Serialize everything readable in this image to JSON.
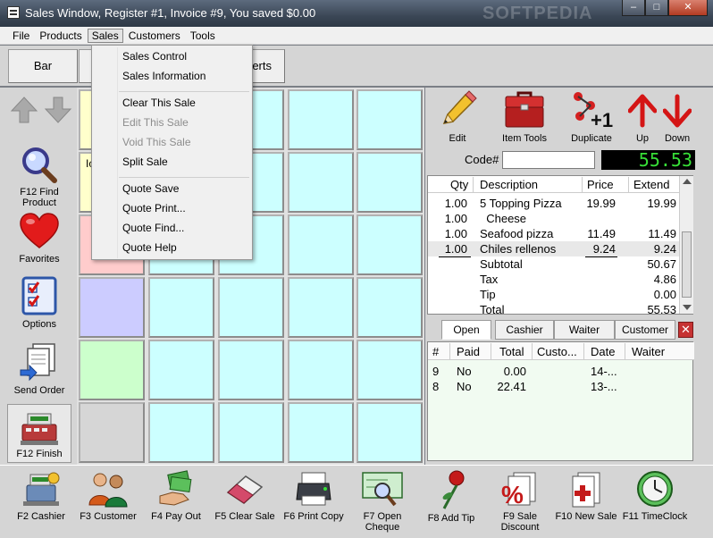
{
  "window": {
    "title": "Sales Window,  Register #1,  Invoice #9, You saved $0.00",
    "watermark": "SOFTPEDIA",
    "btn_minimize": "–",
    "btn_maximize": "□",
    "btn_close": "✕"
  },
  "menubar": {
    "items": [
      "File",
      "Products",
      "Sales",
      "Customers",
      "Tools"
    ]
  },
  "sales_menu": {
    "items": [
      "Sales Control",
      "Sales Information",
      "Clear This Sale",
      "Edit This Sale",
      "Void This Sale",
      "Split Sale",
      "Quote Save",
      "Quote Print...",
      "Quote Find...",
      "Quote Help"
    ]
  },
  "topbar": {
    "tab_bar": "Bar",
    "tab_partial": "erts"
  },
  "sidebar": {
    "find_product": "F12 Find Product",
    "favorites": "Favorites",
    "options": "Options",
    "send_order": "Send Order",
    "finish": "F12 Finish"
  },
  "grid": {
    "partial_label": "Ic"
  },
  "tools": {
    "edit": "Edit",
    "item_tools": "Item Tools",
    "duplicate": "Duplicate",
    "up": "Up",
    "down": "Down"
  },
  "code": {
    "label": "Code#",
    "value": ""
  },
  "total_display": "55.53",
  "order": {
    "headers": [
      "Qty",
      "Description",
      "Price",
      "Extend"
    ],
    "items": [
      {
        "qty": "1.00",
        "desc": "5 Topping Pizza",
        "price": "19.99",
        "extend": "19.99"
      },
      {
        "qty": "1.00",
        "desc": "  Cheese",
        "price": "",
        "extend": ""
      },
      {
        "qty": "1.00",
        "desc": "Seafood pizza",
        "price": "11.49",
        "extend": "11.49"
      },
      {
        "qty": "1.00",
        "desc": "Chiles rellenos",
        "price": "9.24",
        "extend": "9.24"
      }
    ],
    "summary": [
      {
        "label": "Subtotal",
        "value": "50.67"
      },
      {
        "label": "Tax",
        "value": "4.86"
      },
      {
        "label": "Tip",
        "value": "0.00"
      },
      {
        "label": "Total",
        "value": "55.53"
      }
    ]
  },
  "tabs2": [
    "Open",
    "Cashier",
    "Waiter",
    "Customer"
  ],
  "open_list": {
    "headers": [
      "#",
      "Paid",
      "Total",
      "Custo...",
      "Date",
      "Waiter"
    ],
    "rows": [
      {
        "num": "9",
        "paid": "No",
        "total": "0.00",
        "customer": "",
        "date": "14-...",
        "waiter": ""
      },
      {
        "num": "8",
        "paid": "No",
        "total": "22.41",
        "customer": "",
        "date": "13-...",
        "waiter": ""
      }
    ]
  },
  "bottombar": {
    "cashier": "F2 Cashier",
    "customer": "F3 Customer",
    "pay_out": "F4 Pay Out",
    "clear_sale": "F5 Clear Sale",
    "print_copy": "F6 Print Copy",
    "open_cheque": "F7 Open Cheque",
    "add_tip": "F8 Add Tip",
    "sale_discount": "F9 Sale Discount",
    "new_sale": "F10 New Sale",
    "timeclock": "F11 TimeClock"
  },
  "colors": {
    "cell_cyan": "#ccffff",
    "cell_pink": "#ffcccc",
    "cell_lavender": "#ccccff",
    "cell_green": "#ccffcc",
    "cell_gray": "#d6d6d6",
    "cell_yellow": "#ffffcc",
    "accent_red": "#d41515",
    "display_green": "#38e038"
  }
}
